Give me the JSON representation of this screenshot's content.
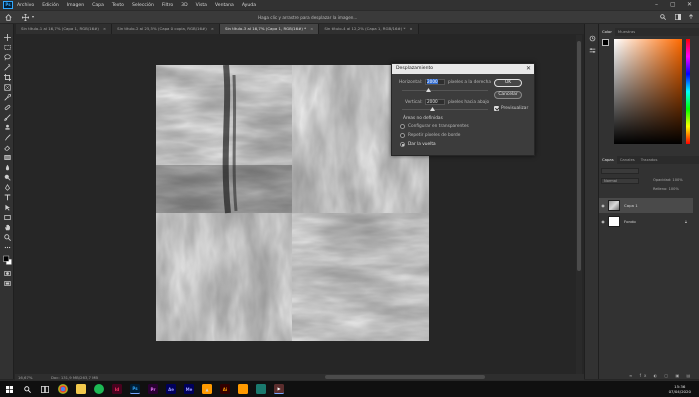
{
  "menubar": {
    "logo": "Ps",
    "items": [
      "Archivo",
      "Edición",
      "Imagen",
      "Capa",
      "Texto",
      "Selección",
      "Filtro",
      "3D",
      "Vista",
      "Ventana",
      "Ayuda"
    ],
    "window_controls": {
      "minimize": "–",
      "maximize": "▢",
      "close": "✕"
    }
  },
  "options_bar": {
    "home_icon": "home-icon",
    "move_icon": "move-icon",
    "hint": "Haga clic y arrastre para desplazar la imagen..."
  },
  "tabs": [
    {
      "label": "Sin título-1 al 16,7% (Capa 1, RGB/16#)",
      "active": false
    },
    {
      "label": "Sin título-2 al 25,5% (Capa 0 copia, RGB/16#)",
      "active": false
    },
    {
      "label": "Sin título-3 al 16,7% (Capa 1, RGB/16#) *",
      "active": true
    },
    {
      "label": "Sin título-4 al 12,2% (Capa 1, RGB/16#) *",
      "active": false
    }
  ],
  "tab_close": "×",
  "dialog": {
    "title": "Desplazamiento",
    "close": "✕",
    "horizontal_label": "Horizontal:",
    "horizontal_value": "2000",
    "horizontal_unit": "píxeles a la derecha",
    "vertical_label": "Vertical:",
    "vertical_value": "2000",
    "vertical_unit": "píxeles hacia abajo",
    "section_label": "Áreas no definidas",
    "options": [
      {
        "label": "Configurar en transparentes",
        "checked": false
      },
      {
        "label": "Repetir píxeles de borde",
        "checked": false
      },
      {
        "label": "Dar la vuelta",
        "checked": true
      }
    ],
    "ok_label": "OK",
    "cancel_label": "Cancelar",
    "preview_label": "Previsualizar",
    "preview_checked": true
  },
  "status": {
    "zoom": "16,67%",
    "doc_info": "Doc: 131,9 MB/263,7 MB"
  },
  "panel": {
    "color_tabs": [
      "Color",
      "Muestras"
    ],
    "layer_tabs": [
      "Capas",
      "Canales",
      "Trazados"
    ],
    "kind_placeholder": "Normal",
    "opacity_label": "Opacidad: 100%",
    "fill_label": "Relleno: 100%",
    "layers": [
      {
        "name": "Capa 1",
        "selected": true,
        "locked": false
      },
      {
        "name": "Fondo",
        "selected": false,
        "locked": true
      }
    ],
    "colors": {
      "foreground": "#000000",
      "background": "#ffffff",
      "picker_hue": "#ff6a00"
    }
  },
  "taskbar": {
    "time": "15:36",
    "date": "07/04/2020",
    "apps": [
      "start",
      "search",
      "task-view",
      "chrome",
      "explorer",
      "spotify",
      "indesign",
      "ps",
      "premiere",
      "aftereffects",
      "audition",
      "acrobat",
      "illustrator",
      "media-encoder",
      "camtasia",
      "video"
    ]
  }
}
